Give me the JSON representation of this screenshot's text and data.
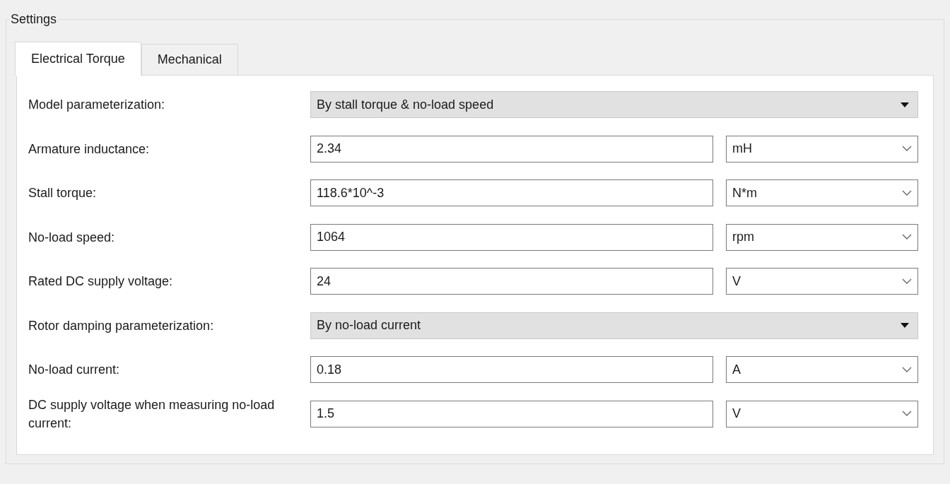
{
  "group": {
    "title": "Settings"
  },
  "tabs": [
    {
      "label": "Electrical Torque",
      "selected": true
    },
    {
      "label": "Mechanical",
      "selected": false
    }
  ],
  "rows": [
    {
      "kind": "select",
      "label": "Model parameterization:",
      "value": "By stall torque & no-load speed"
    },
    {
      "kind": "value",
      "label": "Armature inductance:",
      "value": "2.34",
      "unit": "mH"
    },
    {
      "kind": "value",
      "label": "Stall torque:",
      "value": "118.6*10^-3",
      "unit": "N*m"
    },
    {
      "kind": "value",
      "label": "No-load speed:",
      "value": "1064",
      "unit": "rpm"
    },
    {
      "kind": "value",
      "label": "Rated DC supply voltage:",
      "value": "24",
      "unit": "V"
    },
    {
      "kind": "select",
      "label": "Rotor damping parameterization:",
      "value": "By no-load current"
    },
    {
      "kind": "value",
      "label": "No-load current:",
      "value": "0.18",
      "unit": "A"
    },
    {
      "kind": "value",
      "label": "DC supply voltage when measuring no-load current:",
      "value": "1.5",
      "unit": "V"
    }
  ]
}
